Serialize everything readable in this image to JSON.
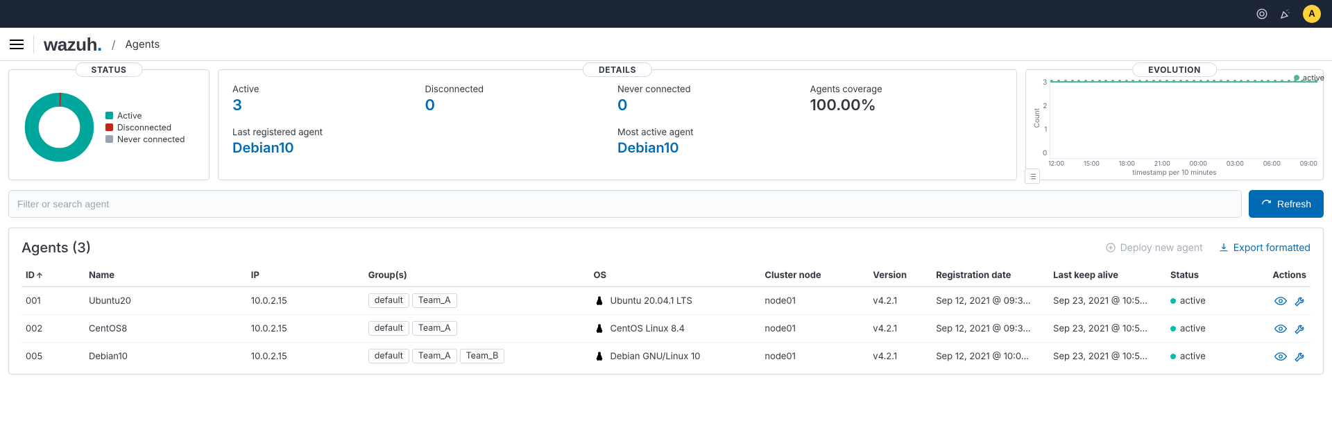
{
  "topbar": {
    "avatar": "A"
  },
  "header": {
    "brand": "wazuh",
    "breadcrumb": "Agents"
  },
  "status": {
    "title": "STATUS",
    "legend": [
      {
        "label": "Active",
        "color": "#00A69B"
      },
      {
        "label": "Disconnected",
        "color": "#BD271E"
      },
      {
        "label": "Never connected",
        "color": "#98A2B3"
      }
    ]
  },
  "details": {
    "title": "DETAILS",
    "active": {
      "label": "Active",
      "value": "3"
    },
    "disconnected": {
      "label": "Disconnected",
      "value": "0"
    },
    "never": {
      "label": "Never connected",
      "value": "0"
    },
    "coverage": {
      "label": "Agents coverage",
      "value": "100.00%"
    },
    "last_registered": {
      "label": "Last registered agent",
      "value": "Debian10"
    },
    "most_active": {
      "label": "Most active agent",
      "value": "Debian10"
    }
  },
  "evolution": {
    "title": "EVOLUTION",
    "legend": "active",
    "yTitle": "Count",
    "xTitle": "timestamp per 10 minutes"
  },
  "chart_data": {
    "type": "line",
    "title": "EVOLUTION",
    "xlabel": "timestamp per 10 minutes",
    "ylabel": "Count",
    "ylim": [
      0,
      3
    ],
    "yTicks": [
      0,
      1,
      2,
      3
    ],
    "categories": [
      "12:00",
      "15:00",
      "18:00",
      "21:00",
      "00:00",
      "03:00",
      "06:00",
      "09:00"
    ],
    "series": [
      {
        "name": "active",
        "color": "#54B399",
        "values": [
          3,
          3,
          3,
          3,
          3,
          3,
          3,
          3
        ]
      }
    ]
  },
  "filter": {
    "placeholder": "Filter or search agent",
    "refresh": "Refresh"
  },
  "table": {
    "title": "Agents (3)",
    "deploy": "Deploy new agent",
    "export": "Export formatted",
    "headers": {
      "id": "ID",
      "name": "Name",
      "ip": "IP",
      "groups": "Group(s)",
      "os": "OS",
      "node": "Cluster node",
      "version": "Version",
      "reg": "Registration date",
      "keep": "Last keep alive",
      "status": "Status",
      "actions": "Actions"
    },
    "rows": [
      {
        "id": "001",
        "name": "Ubuntu20",
        "ip": "10.0.2.15",
        "groups": [
          "default",
          "Team_A"
        ],
        "os": "Ubuntu 20.04.1 LTS",
        "node": "node01",
        "version": "v4.2.1",
        "reg": "Sep 12, 2021 @ 09:3…",
        "keep": "Sep 23, 2021 @ 10:5…",
        "status": "active"
      },
      {
        "id": "002",
        "name": "CentOS8",
        "ip": "10.0.2.15",
        "groups": [
          "default",
          "Team_A"
        ],
        "os": "CentOS Linux 8.4",
        "node": "node01",
        "version": "v4.2.1",
        "reg": "Sep 12, 2021 @ 09:3…",
        "keep": "Sep 23, 2021 @ 10:5…",
        "status": "active"
      },
      {
        "id": "005",
        "name": "Debian10",
        "ip": "10.0.2.15",
        "groups": [
          "default",
          "Team_A",
          "Team_B"
        ],
        "os": "Debian GNU/Linux 10",
        "node": "node01",
        "version": "v4.2.1",
        "reg": "Sep 12, 2021 @ 10:0…",
        "keep": "Sep 23, 2021 @ 10:5…",
        "status": "active"
      }
    ]
  }
}
